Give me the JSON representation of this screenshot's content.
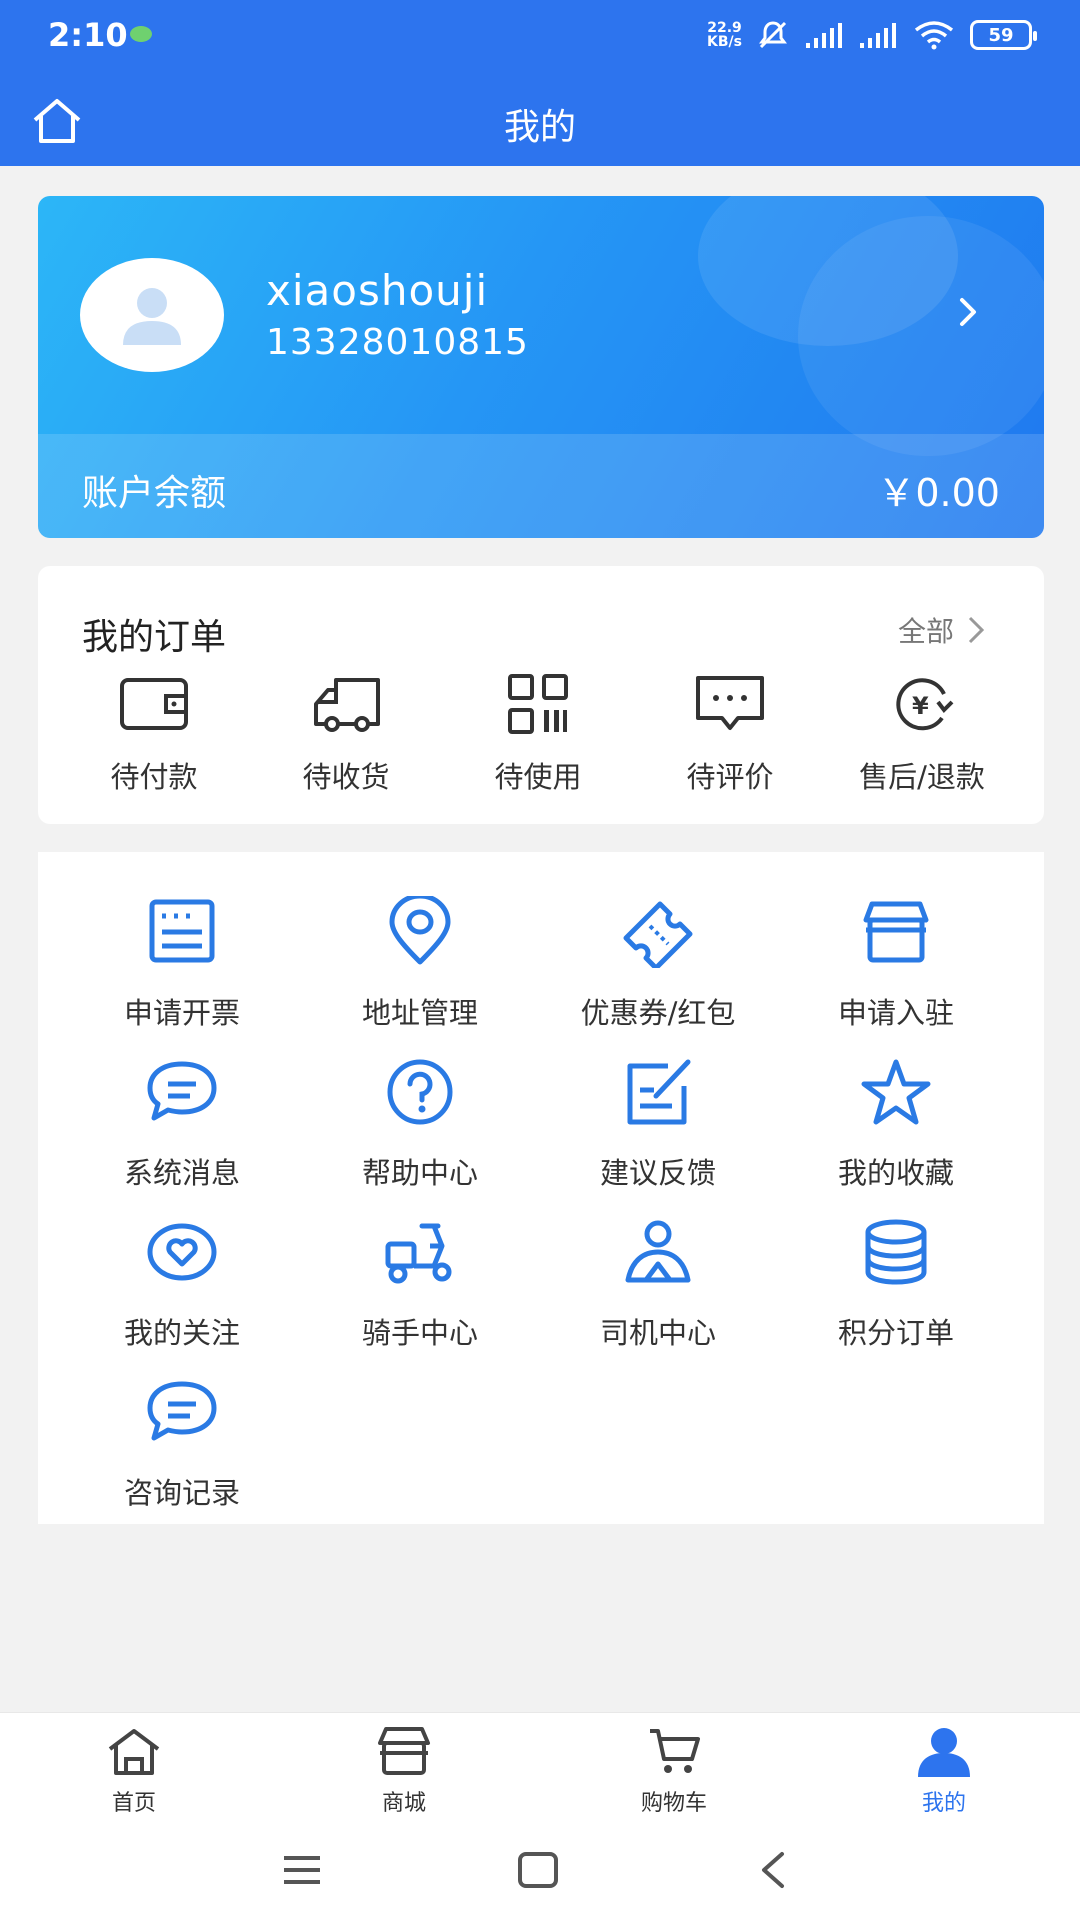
{
  "status": {
    "time": "2:10",
    "net_speed_value": "22.9",
    "net_speed_unit": "KB/s",
    "battery": "59"
  },
  "header": {
    "title": "我的"
  },
  "profile": {
    "username": "xiaoshouji",
    "phone": "13328010815",
    "balance_label": "账户余额",
    "balance_value": "￥0.00"
  },
  "orders": {
    "title": "我的订单",
    "all_label": "全部",
    "items": [
      {
        "label": "待付款",
        "icon": "wallet-icon"
      },
      {
        "label": "待收货",
        "icon": "truck-icon"
      },
      {
        "label": "待使用",
        "icon": "qrcode-icon"
      },
      {
        "label": "待评价",
        "icon": "comment-icon"
      },
      {
        "label": "售后/退款",
        "icon": "refund-icon"
      }
    ]
  },
  "services": [
    {
      "label": "申请开票",
      "icon": "invoice-icon"
    },
    {
      "label": "地址管理",
      "icon": "location-icon"
    },
    {
      "label": "优惠券/红包",
      "icon": "coupon-icon"
    },
    {
      "label": "申请入驻",
      "icon": "store-icon"
    },
    {
      "label": "系统消息",
      "icon": "message-icon"
    },
    {
      "label": "帮助中心",
      "icon": "help-icon"
    },
    {
      "label": "建议反馈",
      "icon": "feedback-icon"
    },
    {
      "label": "我的收藏",
      "icon": "star-icon"
    },
    {
      "label": "我的关注",
      "icon": "heart-icon"
    },
    {
      "label": "骑手中心",
      "icon": "scooter-icon"
    },
    {
      "label": "司机中心",
      "icon": "driver-icon"
    },
    {
      "label": "积分订单",
      "icon": "coins-icon"
    },
    {
      "label": "咨询记录",
      "icon": "consult-icon"
    }
  ],
  "tabs": [
    {
      "label": "首页",
      "icon": "home-icon"
    },
    {
      "label": "商城",
      "icon": "shop-icon"
    },
    {
      "label": "购物车",
      "icon": "cart-icon"
    },
    {
      "label": "我的",
      "icon": "user-icon"
    }
  ],
  "colors": {
    "accent": "#2d74ee",
    "icon_blue": "#2a7ae4",
    "icon_dark": "#333333"
  }
}
